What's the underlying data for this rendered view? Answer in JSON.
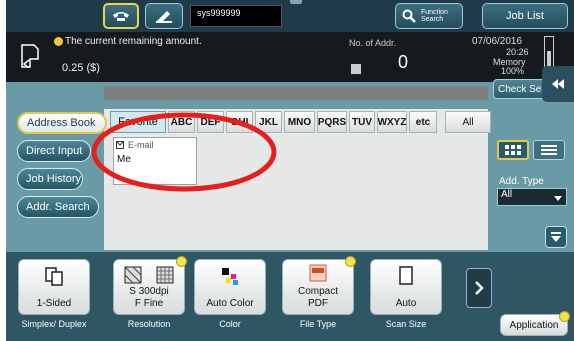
{
  "top_bar": {
    "user_id": "sys999999",
    "function_search_line1": "Function",
    "function_search_line2": "Search",
    "job_list": "Job List"
  },
  "status_bar": {
    "message": "The current remaining amount.",
    "amount": "0.25 ($)",
    "addr_label": "No. of Addr.",
    "addr_count": "0",
    "date": "07/06/2016",
    "time": "20:26",
    "memory_label": "Memory",
    "memory_value": "100%"
  },
  "check_settings": "Check Set",
  "side_menu": {
    "address_book": "Address Book",
    "direct_input": "Direct Input",
    "job_history": "Job History",
    "addr_search": "Addr. Search"
  },
  "tabs": [
    "Favorite",
    "ABC",
    "DEF",
    "GHI",
    "JKL",
    "MNO",
    "PQRS",
    "TUV",
    "WXYZ",
    "etc",
    "All"
  ],
  "entry": {
    "type": "E-mail",
    "name": "Me"
  },
  "add_type": {
    "label": "Add. Type",
    "value": "All"
  },
  "functions": [
    {
      "value": "1-Sided",
      "label": "Simplex/ Duplex"
    },
    {
      "value": "S 300dpi F Fine",
      "value_line1": "S 300dpi",
      "value_line2": "F Fine",
      "label": "Resolution"
    },
    {
      "value": "Auto Color",
      "label": "Color"
    },
    {
      "value_line1": "Compact",
      "value_line2": "PDF",
      "label": "File Type"
    },
    {
      "value": "Auto",
      "label": "Scan Size"
    }
  ],
  "application": "Application",
  "colors": {
    "panel": "#6a9aa5",
    "annotation_red": "#e5201c",
    "highlight_yellow": "#e3c74c"
  },
  "icons": [
    "phone-icon",
    "edit-icon",
    "search-icon",
    "document-icon",
    "bulb-icon",
    "memory-icon",
    "collapse-icon",
    "email-icon",
    "grid-view-icon",
    "list-view-icon",
    "scroll-down-icon",
    "next-icon"
  ]
}
